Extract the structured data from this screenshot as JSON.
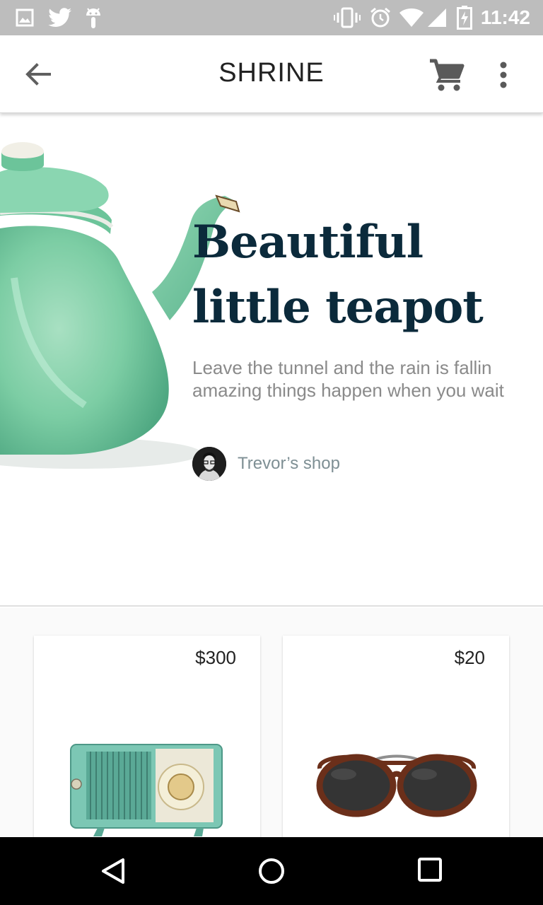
{
  "status_bar": {
    "time": "11:42",
    "left_icons": [
      "image-icon",
      "twitter-icon",
      "android-icon"
    ],
    "right_icons": [
      "vibrate-icon",
      "alarm-icon",
      "wifi-icon",
      "signal-icon",
      "battery-charging-icon"
    ]
  },
  "app_bar": {
    "title": "SHRINE",
    "back_icon": "arrow-back-icon",
    "cart_icon": "shopping-cart-icon",
    "more_icon": "more-vert-icon"
  },
  "featured": {
    "title": "Beautiful little teapot",
    "description": "Leave the tunnel and the rain is fallin amazing things happen when you wait",
    "shop_name": "Trevor’s shop",
    "accent_color": "#0b2a3b"
  },
  "products": [
    {
      "price": "$300",
      "item": "radio"
    },
    {
      "price": "$20",
      "item": "sunglasses"
    }
  ],
  "nav_bar": {
    "back_icon": "nav-back-icon",
    "home_icon": "nav-home-icon",
    "recents_icon": "nav-recents-icon"
  }
}
